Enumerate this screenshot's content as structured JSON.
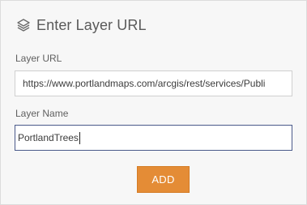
{
  "header": {
    "icon": "layers-icon",
    "title": "Enter Layer URL"
  },
  "form": {
    "layer_url": {
      "label": "Layer URL",
      "value": "https://www.portlandmaps.com/arcgis/rest/services/Publi"
    },
    "layer_name": {
      "label": "Layer Name",
      "value": "PortlandTrees"
    },
    "add_label": "ADD"
  },
  "colors": {
    "panel_bg": "#f7f7f7",
    "accent": "#e48c36",
    "focused_border": "#4a5a8a"
  }
}
